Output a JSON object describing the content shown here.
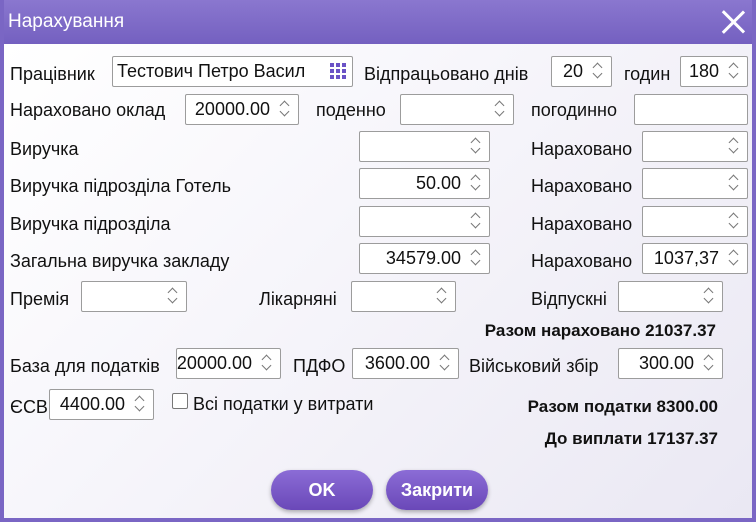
{
  "window": {
    "title": "Нарахування"
  },
  "employee": {
    "label": "Працівник",
    "value": "Тестович Петро Васил"
  },
  "days": {
    "label": "Відпрацьовано днів",
    "value": "20"
  },
  "hours": {
    "label": "годин",
    "value": "180"
  },
  "salary": {
    "label": "Нараховано оклад",
    "value": "20000.00"
  },
  "daily": {
    "label": "поденно",
    "value": ""
  },
  "hourly": {
    "label": "погодинно",
    "value": ""
  },
  "revenue": {
    "label": "Виручка",
    "value": "",
    "accrued_label": "Нараховано",
    "accrued": ""
  },
  "revenue_hotel": {
    "label": "Виручка підрозділа Готель",
    "value": "50.00",
    "accrued_label": "Нараховано",
    "accrued": ""
  },
  "revenue_dept": {
    "label": "Виручка підрозділа",
    "value": "",
    "accrued_label": "Нараховано",
    "accrued": ""
  },
  "revenue_total": {
    "label": "Загальна виручка закладу",
    "value": "34579.00",
    "accrued_label": "Нараховано",
    "accrued": "1037,37"
  },
  "bonus": {
    "label": "Премія",
    "value": ""
  },
  "sick": {
    "label": "Лікарняні",
    "value": ""
  },
  "vacation": {
    "label": "Відпускні",
    "value": ""
  },
  "total_accrued": "Разом нараховано 21037.37",
  "tax_base": {
    "label": "База для податків",
    "value": "20000.00"
  },
  "pdfo": {
    "label": "ПДФО",
    "value": "3600.00"
  },
  "military": {
    "label": "Військовий збір",
    "value": "300.00"
  },
  "esv": {
    "label": "ЄСВ",
    "value": "4400.00"
  },
  "all_taxes": {
    "label": "Всі податки у витрати",
    "checked": false
  },
  "total_taxes": "Разом податки 8300.00",
  "to_pay": "До виплати 17137.37",
  "buttons": {
    "ok": "OK",
    "close": "Закрити"
  }
}
